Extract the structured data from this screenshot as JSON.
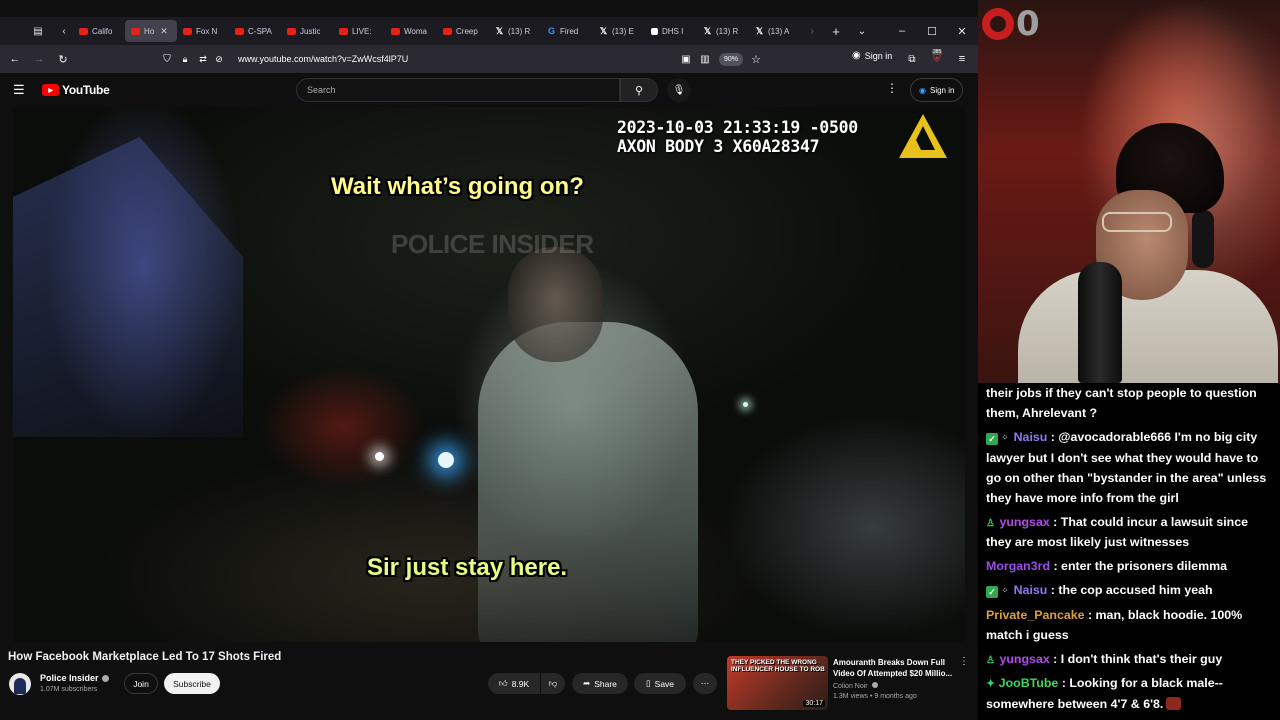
{
  "browser": {
    "tabs": [
      {
        "label": "Califo",
        "favicon": "youtube-icon",
        "active": false
      },
      {
        "label": "Ho",
        "favicon": "youtube-icon",
        "active": true
      },
      {
        "label": "Fox N",
        "favicon": "youtube-icon",
        "active": false
      },
      {
        "label": "C-SPA",
        "favicon": "youtube-icon",
        "active": false
      },
      {
        "label": "Justic",
        "favicon": "youtube-icon",
        "active": false
      },
      {
        "label": "LIVE:",
        "favicon": "youtube-icon",
        "active": false
      },
      {
        "label": "Woma",
        "favicon": "youtube-icon",
        "active": false
      },
      {
        "label": "Creep",
        "favicon": "youtube-icon",
        "active": false
      },
      {
        "label": "(13) R",
        "favicon": "x-icon",
        "active": false
      },
      {
        "label": "Fired",
        "favicon": "google-icon",
        "active": false
      },
      {
        "label": "(13) E",
        "favicon": "x-icon",
        "active": false
      },
      {
        "label": "DHS I",
        "favicon": "document-icon",
        "active": false
      },
      {
        "label": "(13) R",
        "favicon": "x-icon",
        "active": false
      },
      {
        "label": "(13) A",
        "favicon": "x-icon",
        "active": false
      }
    ],
    "url": "www.youtube.com/watch?v=ZwWcsf4lP7U",
    "zoom": "90%",
    "sign_in": "Sign in",
    "extension_badge": "385"
  },
  "youtube": {
    "logo": "YouTube",
    "search_placeholder": "Search",
    "sign_in": "Sign in"
  },
  "video": {
    "bodycam_timestamp": "2023-10-03 21:33:19 -0500",
    "bodycam_device": "AXON BODY 3 X60A28347",
    "watermark": "POLICE INSIDER",
    "caption_top": "Wait what’s going on?",
    "caption_bottom": "Sir just stay here.",
    "title": "How Facebook Marketplace Led To 17 Shots Fired"
  },
  "channel": {
    "name": "Police Insider",
    "subscribers": "1.07M subscribers",
    "join": "Join",
    "subscribe": "Subscribe"
  },
  "actions": {
    "likes": "8.9K",
    "share": "Share",
    "save": "Save"
  },
  "recommended": {
    "thumb_text": "THEY PICKED THE WRONG INFLUENCER HOUSE TO ROB",
    "duration": "30:17",
    "title": "Amouranth Breaks Down Full Video Of Attempted $20 Millio...",
    "channel": "Colion Noir",
    "meta": "1.3M views • 9 months ago"
  },
  "stream_overlay": {
    "counter": "0"
  },
  "chat": [
    {
      "user": "",
      "color": "#ffffff",
      "badges": [],
      "text": "their jobs if they can't stop people to question them, Ahrelevant ?"
    },
    {
      "user": "Naisu",
      "color": "#8a7cf0",
      "badges": [
        "check",
        "dots"
      ],
      "text": "@avocadorable666 I'm no big city lawyer but I don't see what they would have to go on other than \"bystander in the area\" unless they have more info from the girl"
    },
    {
      "user": "yungsax",
      "color": "#b04ce8",
      "badges": [
        "person"
      ],
      "text": "That could incur a lawsuit since they are most likely just witnesses"
    },
    {
      "user": "Morgan3rd",
      "color": "#9a4ee6",
      "badges": [],
      "text": "enter the prisoners dilemma"
    },
    {
      "user": "Naisu",
      "color": "#8a7cf0",
      "badges": [
        "check",
        "dots"
      ],
      "text": "the cop accused him yeah"
    },
    {
      "user": "Private_Pancake",
      "color": "#d9a13a",
      "badges": [],
      "text": "man, black hoodie. 100% match i guess"
    },
    {
      "user": "yungsax",
      "color": "#b04ce8",
      "badges": [
        "person"
      ],
      "text": "I don't think that's their guy"
    },
    {
      "user": "JooBTube",
      "color": "#3fd65a",
      "badges": [
        "diamond"
      ],
      "text": "Looking for a black male--somewhere between 4'7 & 6'8."
    }
  ]
}
